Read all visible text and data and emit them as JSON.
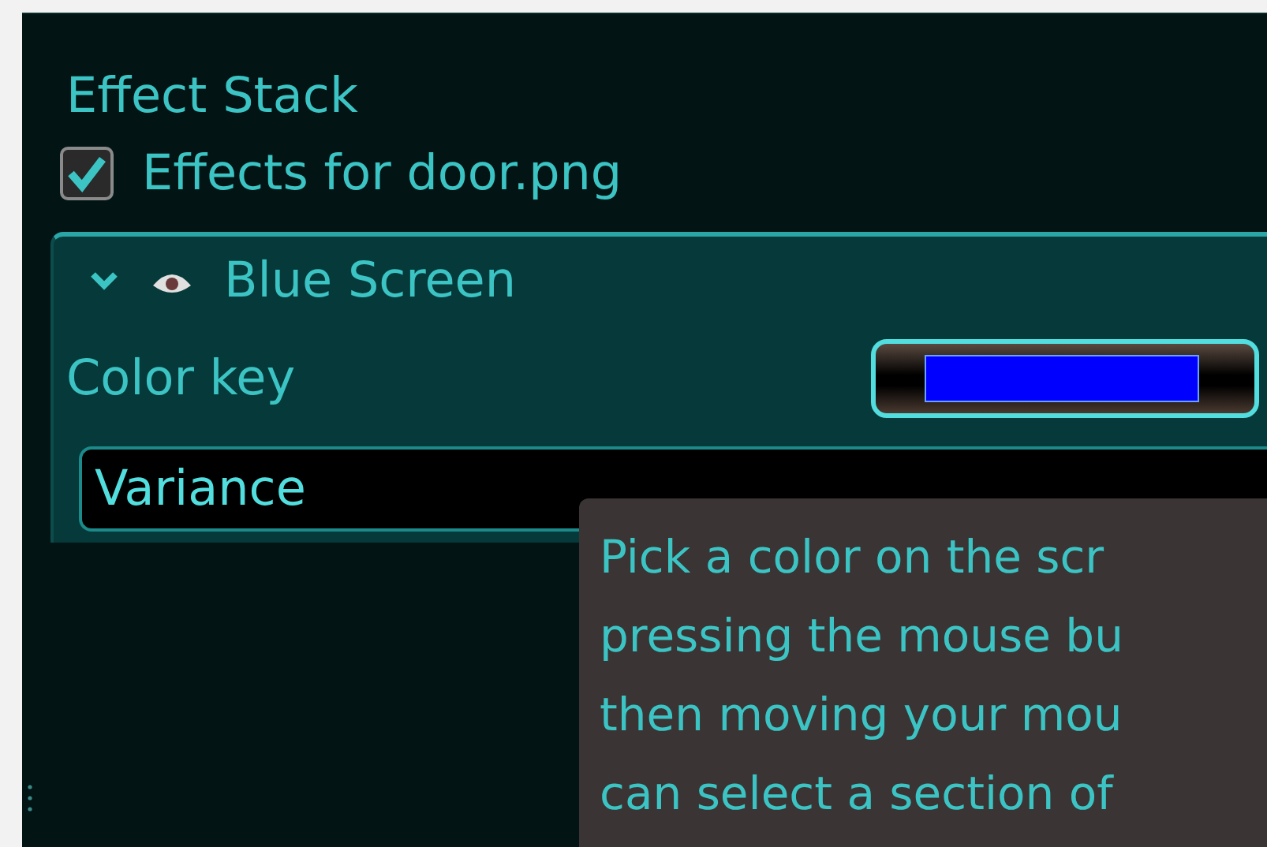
{
  "panel": {
    "title": "Effect Stack"
  },
  "target": {
    "label": "Effects for door.png",
    "checked": true
  },
  "effects": [
    {
      "name": "Blue Screen",
      "expanded": true,
      "visible": true,
      "params": [
        {
          "kind": "color",
          "label": "Color key",
          "color": "#0000ff"
        },
        {
          "kind": "slider",
          "label": "Variance"
        }
      ]
    }
  ],
  "tooltip": {
    "lines": [
      "Pick a color on the scr",
      "pressing the mouse bu",
      "then moving your mou",
      "can select a section of"
    ]
  }
}
